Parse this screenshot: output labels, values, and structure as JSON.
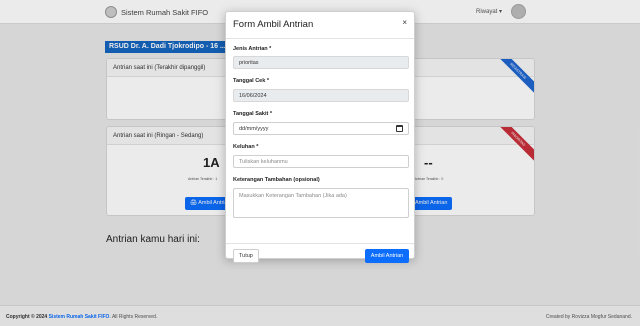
{
  "navbar": {
    "brand": "Sistem Rumah Sakit FIFO",
    "history_label": "Riwayat ▾"
  },
  "hospital_title": "RSUD Dr. A. Dadi Tjokrodipo - 16 ...",
  "card_current": {
    "header": "Antrian saat ini (Terakhir dipanggil)",
    "ribbon": "REGISTRASI"
  },
  "card_light": {
    "header": "Antrian saat ini (Ringan - Sedang)",
    "ribbon": "PRIORITAS",
    "number_left": "1A",
    "note_left": "Antrian Terakhir : 1",
    "number_right": "--",
    "note_right": "Antrian Terakhir : 0",
    "button_left": "🖨 Ambil Antrian",
    "button_right": "Ambil Antrian"
  },
  "today_heading": "Antrian kamu hari ini:",
  "footer": {
    "copyright": "Copyright © 2024",
    "site_link": "Sistem Rumah Sakit FIFO",
    "rights": ". All Rights Reserved.",
    "credit": "Created by Rovizza Mogfur Sedanand."
  },
  "modal": {
    "title": "Form Ambil Antrian",
    "close_symbol": "×",
    "jenis_label": "Jenis Antrian *",
    "jenis_value": "prioritas",
    "tanggal_cek_label": "Tanggal Cek *",
    "tanggal_cek_value": "16/06/2024",
    "tanggal_sakit_label": "Tanggal Sakit *",
    "tanggal_sakit_placeholder": "dd/mm/yyyy",
    "keluhan_label": "Keluhan *",
    "keluhan_placeholder": "Tuliskan keluhanmu",
    "keterangan_label": "Keterangan Tambahan (opsional)",
    "keterangan_placeholder": "Masukkan Keterangan Tambahan (Jika ada)",
    "btn_close": "Tutup",
    "btn_submit": "Ambil Antrian"
  }
}
